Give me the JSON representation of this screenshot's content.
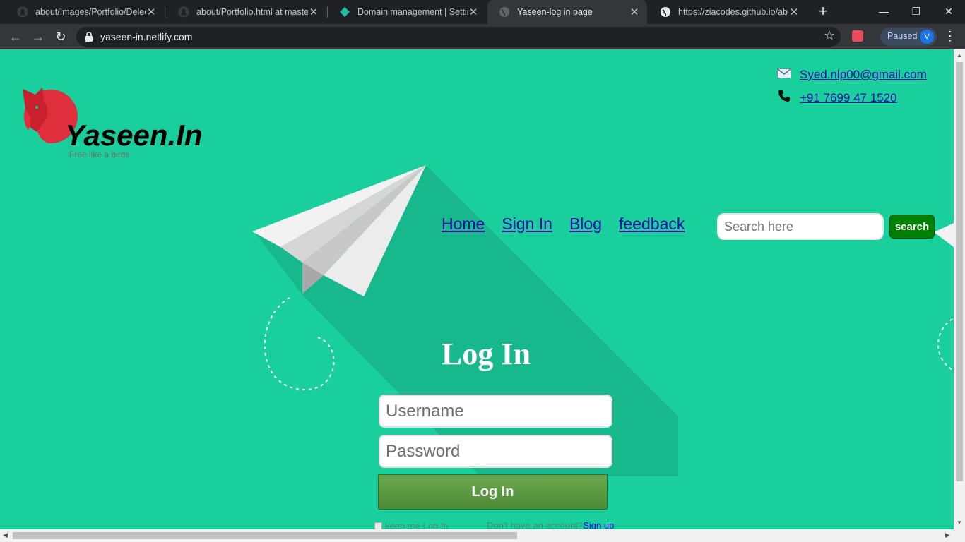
{
  "browser": {
    "tabs": [
      {
        "title": "about/Images/Portfolio/Delect",
        "icon": "github-icon"
      },
      {
        "title": "about/Portfolio.html at master",
        "icon": "github-icon"
      },
      {
        "title": "Domain management | Setting",
        "icon": "netlify-icon"
      },
      {
        "title": "Yaseen-log in page",
        "icon": "globe-icon"
      },
      {
        "title": "https://ziacodes.github.io/abo",
        "icon": "globe-icon"
      }
    ],
    "url": "yaseen-in.netlify.com",
    "profile_status": "Paused",
    "profile_initial": "V"
  },
  "site": {
    "brand": "Yaseen.In",
    "tagline": "Free like a birds",
    "email": "Syed.nlp00@gmail.com",
    "phone": "+91 7699 47 1520",
    "nav": [
      "Home",
      "Sign In",
      "Blog",
      "feedback"
    ],
    "search_placeholder": "Search here",
    "search_button": "search"
  },
  "login": {
    "title": "Log In",
    "username_placeholder": "Username",
    "password_placeholder": "Password",
    "submit": "Log In",
    "remember": "keep me Log In",
    "no_account": "Don't have an account?",
    "signup": "Sign up"
  },
  "colors": {
    "background": "#19cf9c",
    "link": "#1a0dab",
    "search_button": "#008000",
    "login_button": "#5a9a40"
  }
}
